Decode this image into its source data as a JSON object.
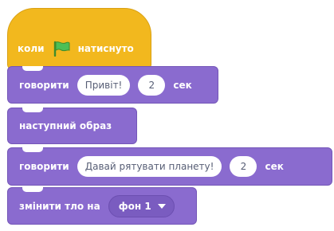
{
  "script": {
    "hat": {
      "before_flag": "коли",
      "flag_icon": "green-flag-icon",
      "after_flag": "натиснуто",
      "color": "#f2b81e"
    },
    "say1": {
      "label": "говорити",
      "message": "Привіт!",
      "seconds": "2",
      "unit": "сек"
    },
    "next_costume": {
      "label": "наступний образ"
    },
    "say2": {
      "label": "говорити",
      "message": "Давай рятувати планету!",
      "seconds": "2",
      "unit": "сек"
    },
    "switch_backdrop": {
      "label": "змінити тло на",
      "value": "фон 1"
    },
    "looks_color": "#8a6bcf"
  }
}
